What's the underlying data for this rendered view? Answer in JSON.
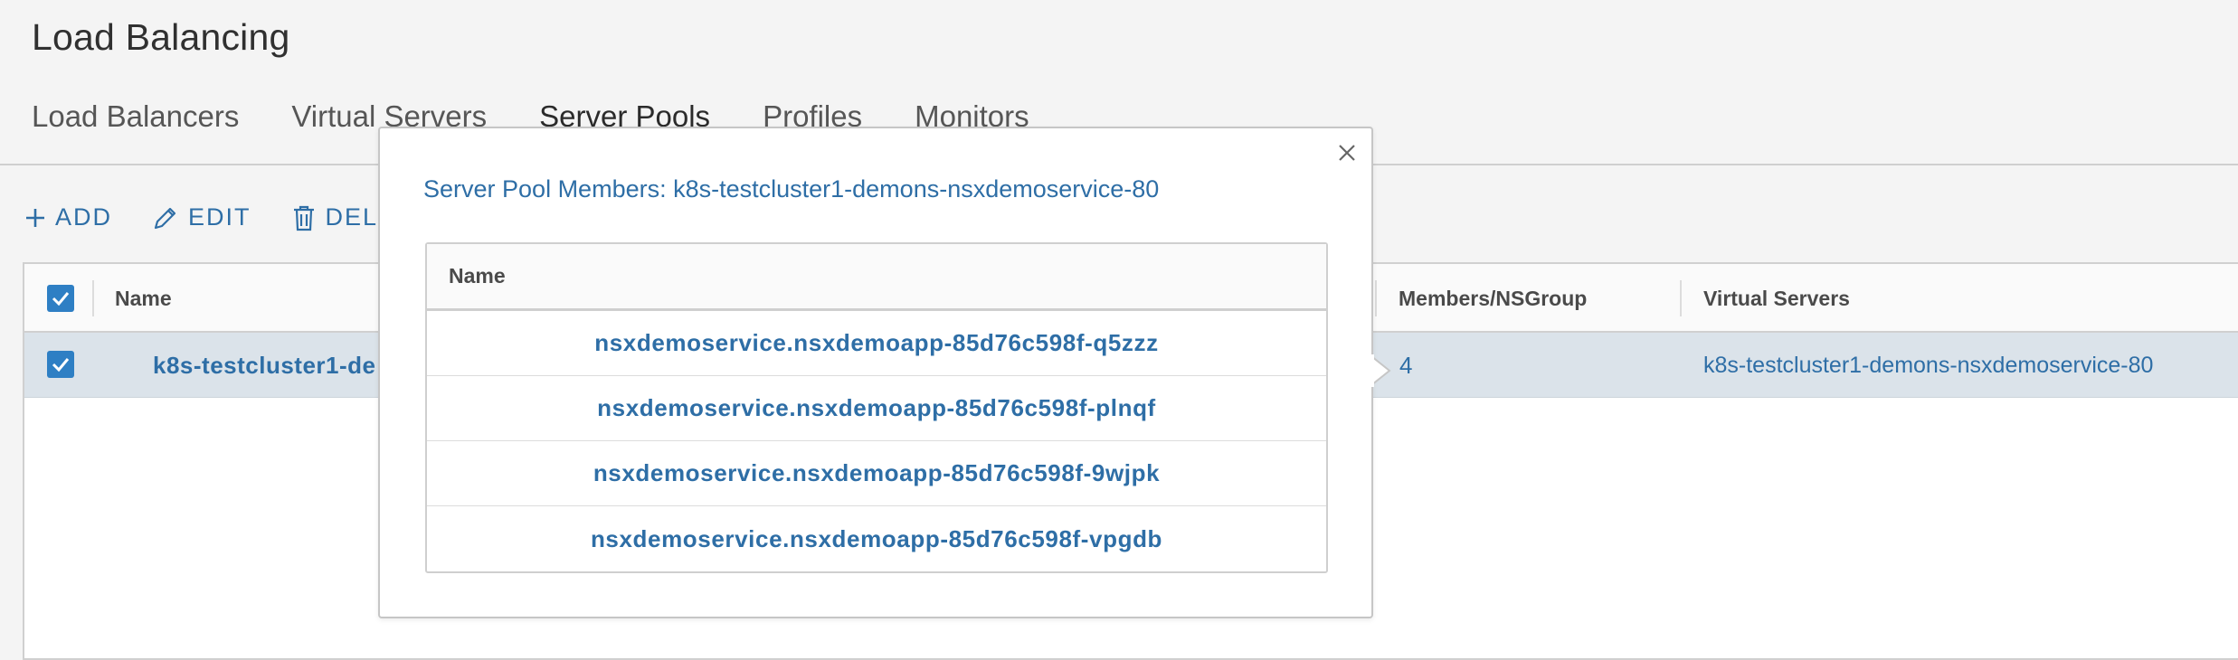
{
  "page": {
    "title": "Load Balancing"
  },
  "tabs": [
    {
      "label": "Load Balancers",
      "active": false
    },
    {
      "label": "Virtual Servers",
      "active": false
    },
    {
      "label": "Server Pools",
      "active": true
    },
    {
      "label": "Profiles",
      "active": false
    },
    {
      "label": "Monitors",
      "active": false
    }
  ],
  "toolbar": {
    "add_label": "ADD",
    "edit_label": "EDIT",
    "delete_label": "DEL"
  },
  "grid": {
    "columns": {
      "name": "Name",
      "members": "Members/NSGroup",
      "virtual_servers": "Virtual Servers"
    },
    "rows": [
      {
        "name": "k8s-testcluster1-de",
        "members": "4",
        "virtual_servers": "k8s-testcluster1-demons-nsxdemoservice-80",
        "selected": true
      }
    ]
  },
  "popover": {
    "title": "Server Pool Members: k8s-testcluster1-demons-nsxdemoservice-80",
    "table_header": "Name",
    "members": [
      "nsxdemoservice.nsxdemoapp-85d76c598f-q5zzz",
      "nsxdemoservice.nsxdemoapp-85d76c598f-plnqf",
      "nsxdemoservice.nsxdemoapp-85d76c598f-9wjpk",
      "nsxdemoservice.nsxdemoapp-85d76c598f-vpgdb"
    ]
  },
  "colors": {
    "accent": "#0072a3",
    "link": "#2e6ea6",
    "checkbox": "#2e7fc4",
    "selected_row": "#dbe3ea"
  }
}
